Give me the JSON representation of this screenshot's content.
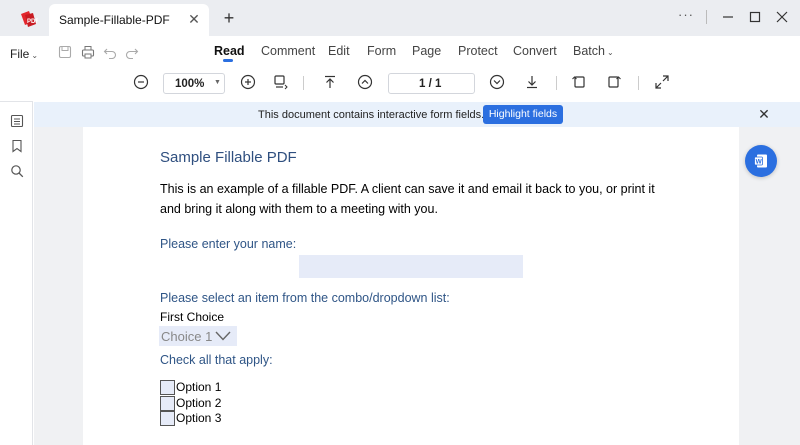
{
  "window": {
    "tab_title": "Sample-Fillable-PDF",
    "tab_close_icon": "close-icon",
    "new_tab_icon": "plus-icon",
    "more_label": "···"
  },
  "menu": {
    "file_label": "File",
    "items": [
      {
        "label": "Read",
        "active": true
      },
      {
        "label": "Comment"
      },
      {
        "label": "Edit"
      },
      {
        "label": "Form"
      },
      {
        "label": "Page"
      },
      {
        "label": "Protect"
      },
      {
        "label": "Convert"
      },
      {
        "label": "Batch"
      }
    ]
  },
  "toolbar": {
    "zoom": "100%",
    "page_indicator": "1  / 1"
  },
  "notice": {
    "text": "This document contains interactive form fields.",
    "highlight_button": "Highlight fields"
  },
  "document": {
    "title": "Sample Fillable PDF",
    "paragraph": "This is an example of a fillable PDF. A client can save it and email it back to you, or print it and bring it along with them to a meeting with you.",
    "name_label": "Please enter your name:",
    "name_value": "",
    "combo_label": "Please select an item from the combo/dropdown list:",
    "combo_option_text": "First Choice",
    "combo_value": "Choice 1",
    "checkbox_label": "Check all that apply:",
    "checkboxes": [
      {
        "label": "Option 1",
        "checked": false
      },
      {
        "label": "Option 2",
        "checked": false
      },
      {
        "label": "Option 3",
        "checked": false
      }
    ]
  },
  "colors": {
    "accent": "#2b6fe0",
    "title_text": "#2f4f7f",
    "field_bg": "#e6ebf8",
    "notice_bg": "#e9f1fb"
  }
}
